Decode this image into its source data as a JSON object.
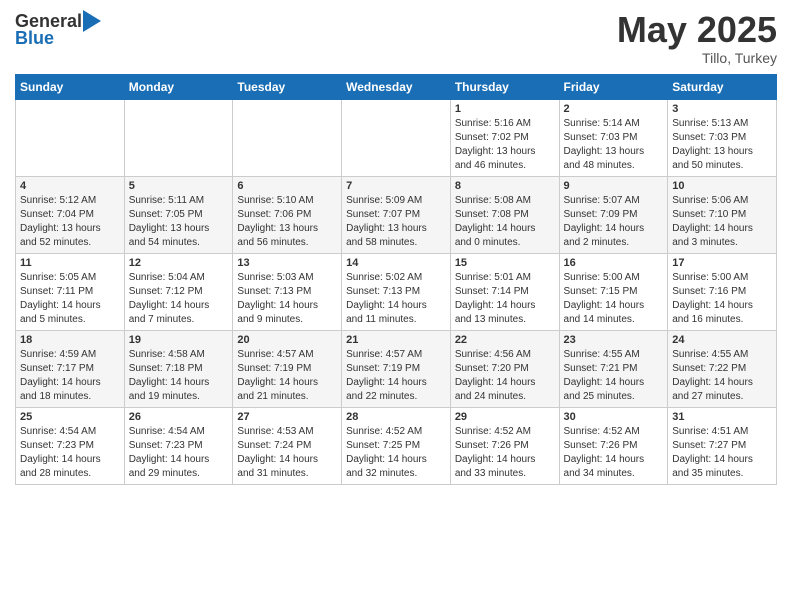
{
  "header": {
    "logo_general": "General",
    "logo_blue": "Blue",
    "month": "May 2025",
    "location": "Tillo, Turkey"
  },
  "weekdays": [
    "Sunday",
    "Monday",
    "Tuesday",
    "Wednesday",
    "Thursday",
    "Friday",
    "Saturday"
  ],
  "weeks": [
    [
      {
        "day": "",
        "sunrise": "",
        "sunset": "",
        "daylight": ""
      },
      {
        "day": "",
        "sunrise": "",
        "sunset": "",
        "daylight": ""
      },
      {
        "day": "",
        "sunrise": "",
        "sunset": "",
        "daylight": ""
      },
      {
        "day": "",
        "sunrise": "",
        "sunset": "",
        "daylight": ""
      },
      {
        "day": "1",
        "sunrise": "Sunrise: 5:16 AM",
        "sunset": "Sunset: 7:02 PM",
        "daylight": "Daylight: 13 hours and 46 minutes."
      },
      {
        "day": "2",
        "sunrise": "Sunrise: 5:14 AM",
        "sunset": "Sunset: 7:03 PM",
        "daylight": "Daylight: 13 hours and 48 minutes."
      },
      {
        "day": "3",
        "sunrise": "Sunrise: 5:13 AM",
        "sunset": "Sunset: 7:03 PM",
        "daylight": "Daylight: 13 hours and 50 minutes."
      }
    ],
    [
      {
        "day": "4",
        "sunrise": "Sunrise: 5:12 AM",
        "sunset": "Sunset: 7:04 PM",
        "daylight": "Daylight: 13 hours and 52 minutes."
      },
      {
        "day": "5",
        "sunrise": "Sunrise: 5:11 AM",
        "sunset": "Sunset: 7:05 PM",
        "daylight": "Daylight: 13 hours and 54 minutes."
      },
      {
        "day": "6",
        "sunrise": "Sunrise: 5:10 AM",
        "sunset": "Sunset: 7:06 PM",
        "daylight": "Daylight: 13 hours and 56 minutes."
      },
      {
        "day": "7",
        "sunrise": "Sunrise: 5:09 AM",
        "sunset": "Sunset: 7:07 PM",
        "daylight": "Daylight: 13 hours and 58 minutes."
      },
      {
        "day": "8",
        "sunrise": "Sunrise: 5:08 AM",
        "sunset": "Sunset: 7:08 PM",
        "daylight": "Daylight: 14 hours and 0 minutes."
      },
      {
        "day": "9",
        "sunrise": "Sunrise: 5:07 AM",
        "sunset": "Sunset: 7:09 PM",
        "daylight": "Daylight: 14 hours and 2 minutes."
      },
      {
        "day": "10",
        "sunrise": "Sunrise: 5:06 AM",
        "sunset": "Sunset: 7:10 PM",
        "daylight": "Daylight: 14 hours and 3 minutes."
      }
    ],
    [
      {
        "day": "11",
        "sunrise": "Sunrise: 5:05 AM",
        "sunset": "Sunset: 7:11 PM",
        "daylight": "Daylight: 14 hours and 5 minutes."
      },
      {
        "day": "12",
        "sunrise": "Sunrise: 5:04 AM",
        "sunset": "Sunset: 7:12 PM",
        "daylight": "Daylight: 14 hours and 7 minutes."
      },
      {
        "day": "13",
        "sunrise": "Sunrise: 5:03 AM",
        "sunset": "Sunset: 7:13 PM",
        "daylight": "Daylight: 14 hours and 9 minutes."
      },
      {
        "day": "14",
        "sunrise": "Sunrise: 5:02 AM",
        "sunset": "Sunset: 7:13 PM",
        "daylight": "Daylight: 14 hours and 11 minutes."
      },
      {
        "day": "15",
        "sunrise": "Sunrise: 5:01 AM",
        "sunset": "Sunset: 7:14 PM",
        "daylight": "Daylight: 14 hours and 13 minutes."
      },
      {
        "day": "16",
        "sunrise": "Sunrise: 5:00 AM",
        "sunset": "Sunset: 7:15 PM",
        "daylight": "Daylight: 14 hours and 14 minutes."
      },
      {
        "day": "17",
        "sunrise": "Sunrise: 5:00 AM",
        "sunset": "Sunset: 7:16 PM",
        "daylight": "Daylight: 14 hours and 16 minutes."
      }
    ],
    [
      {
        "day": "18",
        "sunrise": "Sunrise: 4:59 AM",
        "sunset": "Sunset: 7:17 PM",
        "daylight": "Daylight: 14 hours and 18 minutes."
      },
      {
        "day": "19",
        "sunrise": "Sunrise: 4:58 AM",
        "sunset": "Sunset: 7:18 PM",
        "daylight": "Daylight: 14 hours and 19 minutes."
      },
      {
        "day": "20",
        "sunrise": "Sunrise: 4:57 AM",
        "sunset": "Sunset: 7:19 PM",
        "daylight": "Daylight: 14 hours and 21 minutes."
      },
      {
        "day": "21",
        "sunrise": "Sunrise: 4:57 AM",
        "sunset": "Sunset: 7:19 PM",
        "daylight": "Daylight: 14 hours and 22 minutes."
      },
      {
        "day": "22",
        "sunrise": "Sunrise: 4:56 AM",
        "sunset": "Sunset: 7:20 PM",
        "daylight": "Daylight: 14 hours and 24 minutes."
      },
      {
        "day": "23",
        "sunrise": "Sunrise: 4:55 AM",
        "sunset": "Sunset: 7:21 PM",
        "daylight": "Daylight: 14 hours and 25 minutes."
      },
      {
        "day": "24",
        "sunrise": "Sunrise: 4:55 AM",
        "sunset": "Sunset: 7:22 PM",
        "daylight": "Daylight: 14 hours and 27 minutes."
      }
    ],
    [
      {
        "day": "25",
        "sunrise": "Sunrise: 4:54 AM",
        "sunset": "Sunset: 7:23 PM",
        "daylight": "Daylight: 14 hours and 28 minutes."
      },
      {
        "day": "26",
        "sunrise": "Sunrise: 4:54 AM",
        "sunset": "Sunset: 7:23 PM",
        "daylight": "Daylight: 14 hours and 29 minutes."
      },
      {
        "day": "27",
        "sunrise": "Sunrise: 4:53 AM",
        "sunset": "Sunset: 7:24 PM",
        "daylight": "Daylight: 14 hours and 31 minutes."
      },
      {
        "day": "28",
        "sunrise": "Sunrise: 4:52 AM",
        "sunset": "Sunset: 7:25 PM",
        "daylight": "Daylight: 14 hours and 32 minutes."
      },
      {
        "day": "29",
        "sunrise": "Sunrise: 4:52 AM",
        "sunset": "Sunset: 7:26 PM",
        "daylight": "Daylight: 14 hours and 33 minutes."
      },
      {
        "day": "30",
        "sunrise": "Sunrise: 4:52 AM",
        "sunset": "Sunset: 7:26 PM",
        "daylight": "Daylight: 14 hours and 34 minutes."
      },
      {
        "day": "31",
        "sunrise": "Sunrise: 4:51 AM",
        "sunset": "Sunset: 7:27 PM",
        "daylight": "Daylight: 14 hours and 35 minutes."
      }
    ]
  ]
}
